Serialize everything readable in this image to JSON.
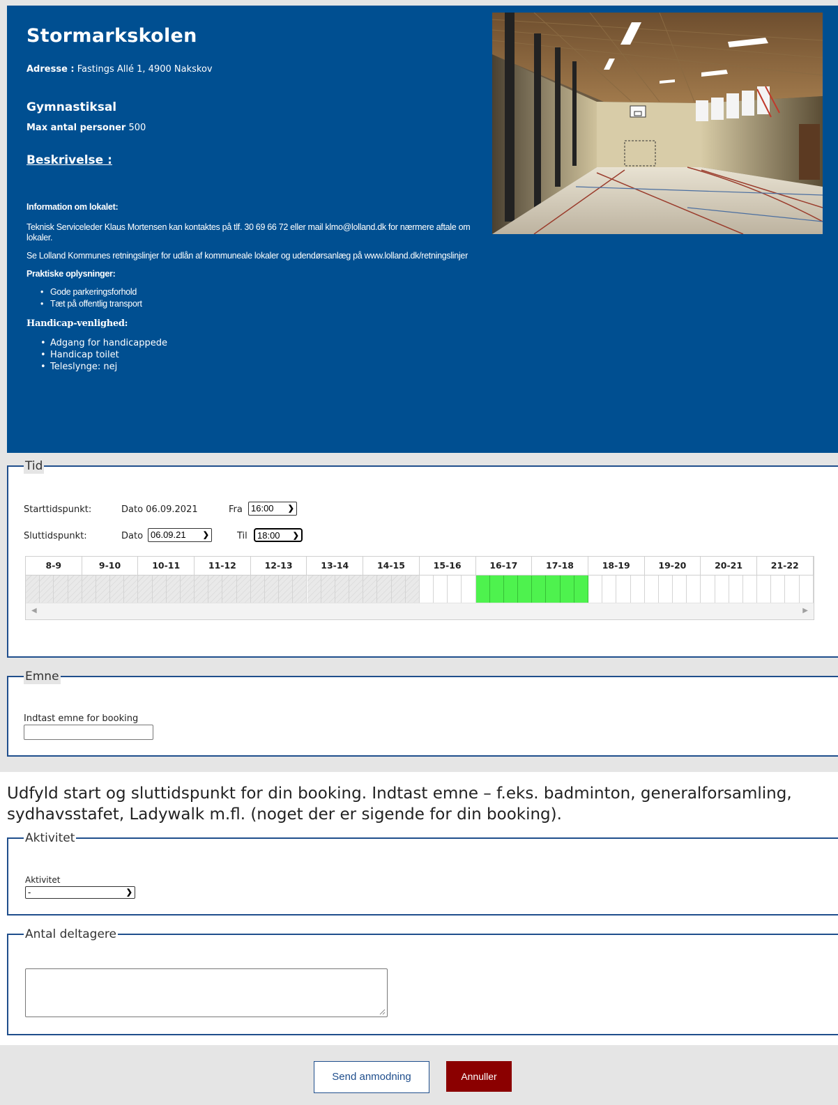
{
  "venue": {
    "name": "Stormarkskolen",
    "address_label": "Adresse :",
    "address": "Fastings Allé 1, 4900 Nakskov",
    "room": "Gymnastiksal",
    "max_label": "Max antal personer",
    "max_value": "500",
    "description_heading": "Beskrivelse :",
    "info_heading": "Information om lokalet:",
    "info_p1": "Teknisk Serviceleder Klaus Mortensen kan kontaktes på tlf. 30 69 66 72 eller mail klmo@lolland.dk for nærmere aftale om lokaler.",
    "info_p2": "Se Lolland Kommunes retningslinjer for udlån af kommuneale lokaler og udendørsanlæg på www.lolland.dk/retningslinjer",
    "practical_heading": "Praktiske oplysninger:",
    "practical": [
      "Gode parkeringsforhold",
      "Tæt på offentlig transport"
    ],
    "handicap_heading": "Handicap-venlighed:",
    "handicap": [
      "Adgang for handicappede",
      "Handicap toilet",
      "Teleslynge: nej"
    ]
  },
  "tid": {
    "legend": "Tid",
    "start_label": "Starttidspunkt:",
    "start_date_label": "Dato",
    "start_date": "06.09.2021",
    "from_label": "Fra",
    "from_value": "16:00",
    "end_label": "Sluttidspunkt:",
    "end_date_label": "Dato",
    "end_date": "06.09.21",
    "to_label": "Til",
    "to_value": "18:00",
    "hours": [
      "8-9",
      "9-10",
      "10-11",
      "11-12",
      "12-13",
      "13-14",
      "14-15",
      "15-16",
      "16-17",
      "17-18",
      "18-19",
      "19-20",
      "20-21",
      "21-22"
    ],
    "past_until_hour_index": 7,
    "selected_hours": [
      8,
      9
    ],
    "scroll_left_icon": "arrow-left",
    "scroll_right_icon": "arrow-right"
  },
  "emne": {
    "legend": "Emne",
    "field_label": "Indtast emne for booking",
    "value": ""
  },
  "instructions": "Udfyld start og sluttidspunkt for din booking. Indtast emne – f.eks. badminton, generalforsamling, sydhavsstafet, Ladywalk m.fl. (noget der er sigende for din booking).",
  "aktivitet": {
    "legend": "Aktivitet",
    "field_label": "Aktivitet",
    "selected": "-"
  },
  "deltagere": {
    "legend": "Antal deltagere",
    "value": ""
  },
  "buttons": {
    "send": "Send anmodning",
    "cancel": "Annuller"
  },
  "colors": {
    "brand_blue": "#004f91",
    "selected_green": "#4ef24e",
    "cancel_red": "#8b0000"
  }
}
